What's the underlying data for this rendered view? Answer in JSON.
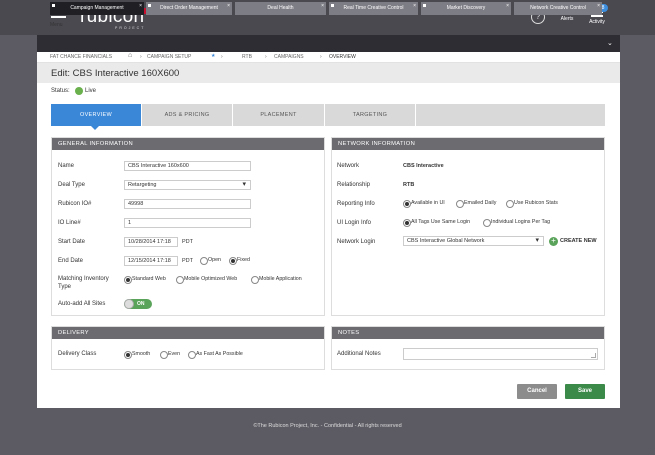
{
  "app": {
    "menu_label": "Menu",
    "logo_text": "rubicon",
    "logo_sub": "PROJECT",
    "help_glyph": "?",
    "alerts_label": "Alerts",
    "alerts_count": "43",
    "activity_label": "Activity",
    "activity_count": "8"
  },
  "window_tabs": [
    {
      "label": "Campaign Management",
      "active": true
    },
    {
      "label": "Direct Order Management"
    },
    {
      "label": "Deal Health"
    },
    {
      "label": "Real Time Creative Control"
    },
    {
      "label": "Market Discovery"
    },
    {
      "label": "Network Creative Control"
    }
  ],
  "tab_close_glyph": "×",
  "tabs_more_glyph": "⌄",
  "breadcrumb": {
    "root": "FAT CHANCE FINANCIALS",
    "items": [
      "CAMPAIGN SETUP",
      "RTB",
      "CAMPAIGNS",
      "OVERVIEW"
    ],
    "sep": "›"
  },
  "page_title": "Edit: CBS Interactive 160X600",
  "status": {
    "label": "Status:",
    "value": "Live"
  },
  "section_tabs": [
    "OVERVIEW",
    "ADS & PRICING",
    "PLACEMENT",
    "TARGETING"
  ],
  "general": {
    "header": "GENERAL INFORMATION",
    "name_label": "Name",
    "name_value": "CBS Interactive 160x600",
    "deal_type_label": "Deal Type",
    "deal_type_value": "Retargeting",
    "io_label": "Rubicon IO#",
    "io_value": "49998",
    "io_line_label": "IO Line#",
    "io_line_value": "1",
    "start_label": "Start Date",
    "start_value": "10/28/2014 17:18",
    "start_tz": "PDT",
    "end_label": "End Date",
    "end_value": "12/15/2014 17:18",
    "end_tz": "PDT",
    "end_open": "Open",
    "end_fixed": "Fixed",
    "inventory_label_1": "Matching Inventory",
    "inventory_label_2": "Type",
    "inventory_options": [
      "Standard Web",
      "Mobile Optimized Web",
      "Mobile Application"
    ],
    "autoadd_label": "Auto-add All Sites",
    "autoadd_value": "ON"
  },
  "network": {
    "header": "NETWORK INFORMATION",
    "network_label": "Network",
    "network_value": "CBS Interactive",
    "relationship_label": "Relationship",
    "relationship_value": "RTB",
    "reporting_label": "Reporting Info",
    "reporting_options": [
      "Available in UI",
      "Emailed Daily",
      "Use Rubicon Stats"
    ],
    "login_info_label": "UI Login Info",
    "login_info_options": [
      "All Tags Use Same Login",
      "Individual Logins Per Tag"
    ],
    "network_login_label": "Network Login",
    "network_login_value": "CBS Interactive Global Network",
    "create_new": "CREATE NEW",
    "plus_glyph": "+"
  },
  "delivery": {
    "header": "DELIVERY",
    "class_label": "Delivery Class",
    "options": [
      "Smooth",
      "Even",
      "As Fast As Possible"
    ]
  },
  "notes": {
    "header": "NOTES",
    "label": "Additional Notes"
  },
  "buttons": {
    "cancel": "Cancel",
    "save": "Save"
  },
  "footer": "©The Rubicon Project, Inc. - Confidential - All rights reserved",
  "colors": {
    "accent": "#3a87d8",
    "save": "#3c8a4a",
    "live": "#6ab04c",
    "alert_badge": "#e02929"
  }
}
